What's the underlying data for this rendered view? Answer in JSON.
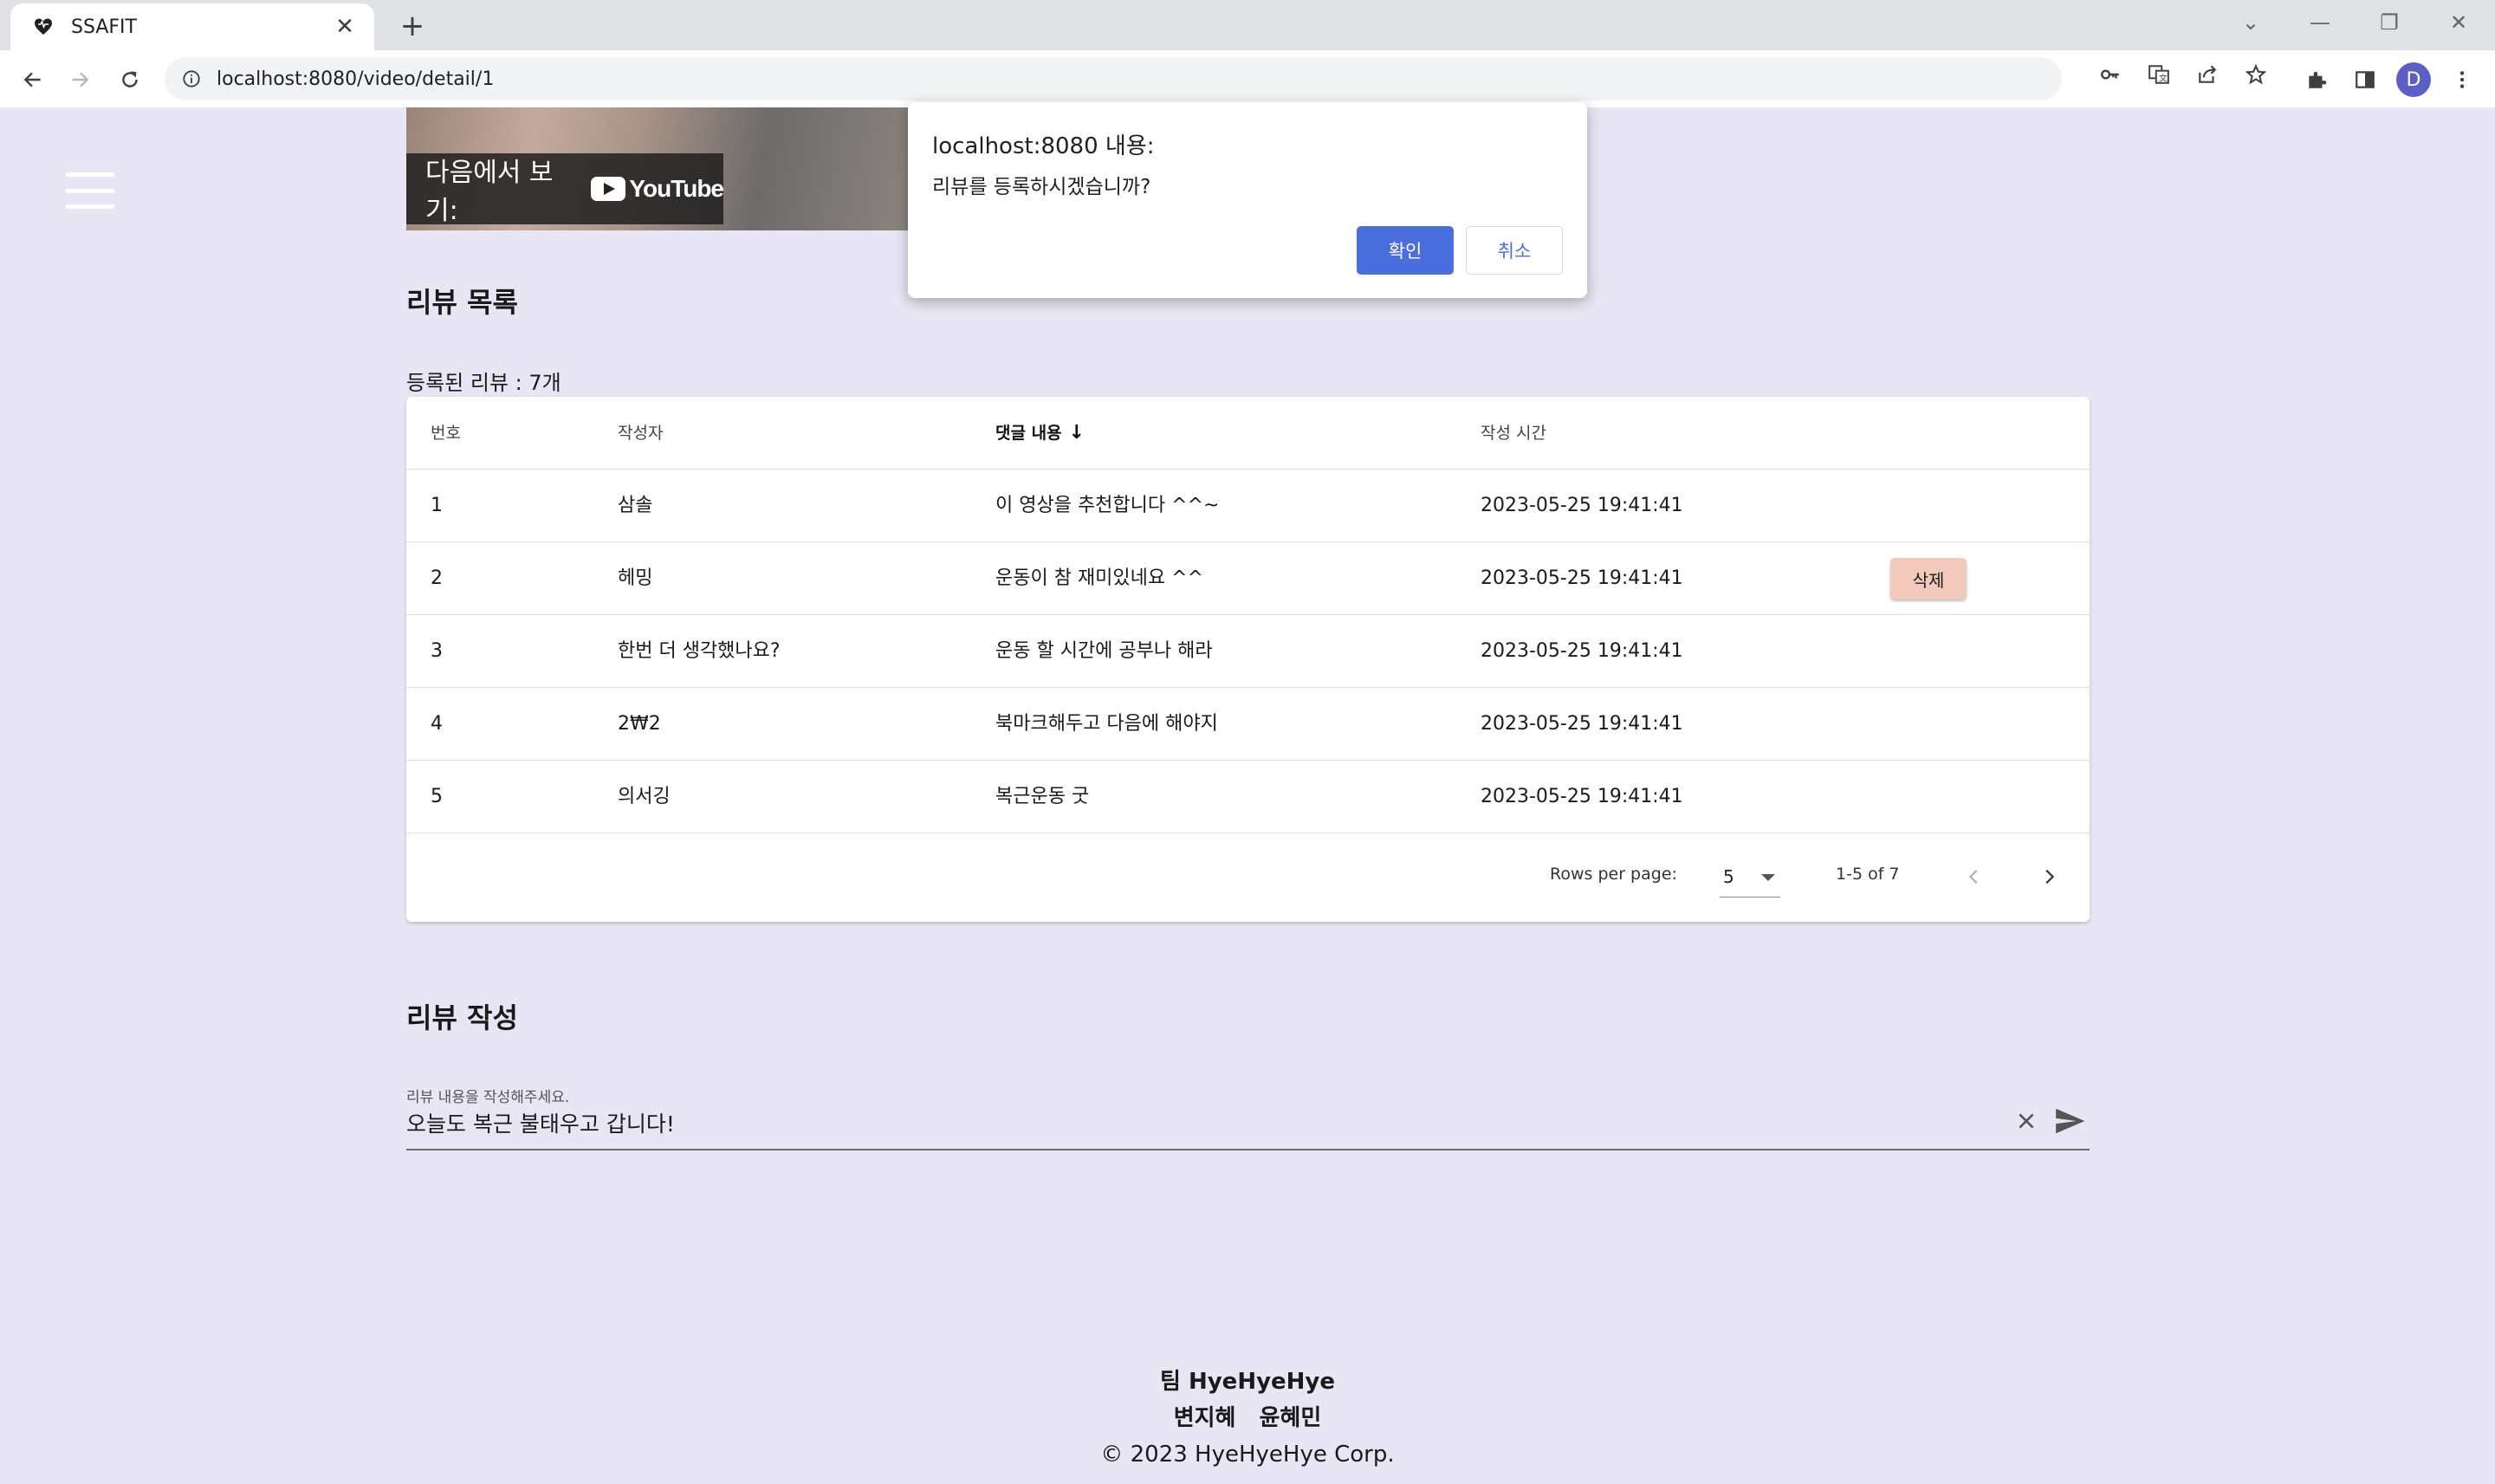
{
  "browser": {
    "tab_title": "SSAFIT",
    "url": "localhost:8080/video/detail/1",
    "profile_initial": "D",
    "icons": [
      "heart-favicon",
      "close-icon",
      "plus-icon",
      "back-icon",
      "forward-icon",
      "reload-icon",
      "info-icon",
      "key-icon",
      "translate-icon",
      "share-icon",
      "star-icon",
      "puzzle-icon",
      "sidepanel-icon",
      "kebab-icon"
    ]
  },
  "video": {
    "watch_on_label": "다음에서 보기:",
    "platform_label": "YouTube"
  },
  "reviews": {
    "section_title": "리뷰 목록",
    "count_label": "등록된 리뷰 : 7개",
    "columns": [
      "번호",
      "작성자",
      "댓글 내용",
      "작성 시간"
    ],
    "rows": [
      {
        "no": "1",
        "writer": "삼솔",
        "content": "이 영상을 추천합니다 ^^~",
        "time": "2023-05-25 19:41:41"
      },
      {
        "no": "2",
        "writer": "헤밍",
        "content": "운동이 참 재미있네요 ^^",
        "time": "2023-05-25 19:41:41",
        "delete_label": "삭제"
      },
      {
        "no": "3",
        "writer": "한번 더 생각했나요?",
        "content": "운동 할 시간에 공부나 해라",
        "time": "2023-05-25 19:41:41"
      },
      {
        "no": "4",
        "writer": "2₩2",
        "content": "북마크해두고 다음에 해야지",
        "time": "2023-05-25 19:41:41"
      },
      {
        "no": "5",
        "writer": "의서깅",
        "content": "복근운동 굿",
        "time": "2023-05-25 19:41:41"
      }
    ],
    "pagination": {
      "rows_per_page_label": "Rows per page:",
      "rows_per_page_value": "5",
      "range_label": "1-5 of 7"
    }
  },
  "write": {
    "section_title": "리뷰 작성",
    "field_label": "리뷰 내용을 작성해주세요.",
    "field_value": "오늘도 복근 불태우고 갑니다!"
  },
  "footer": {
    "team": "팀 HyeHyeHye",
    "members": "변지혜 윤혜민",
    "copyright": "© 2023 HyeHyeHye Corp."
  },
  "dialog": {
    "title": "localhost:8080 내용:",
    "message": "리뷰를 등록하시겠습니까?",
    "ok_label": "확인",
    "cancel_label": "취소"
  },
  "colors": {
    "page_background": "#e8e6f4",
    "primary_button": "#4a6fdc",
    "delete_button": "#f2cabb"
  }
}
